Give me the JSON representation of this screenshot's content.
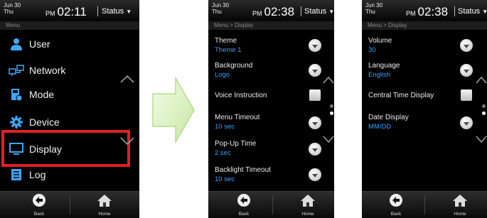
{
  "screens": [
    {
      "date_month": "Jun",
      "date_day": "30",
      "date_weekday": "Thu",
      "ampm": "PM",
      "time": "02:11",
      "status_label": "Status",
      "breadcrumb": "Menu",
      "menu_items": [
        {
          "label": "User",
          "icon": "user-icon"
        },
        {
          "label": "Network",
          "icon": "network-icon"
        },
        {
          "label": "Mode",
          "icon": "mode-icon"
        },
        {
          "label": "Device",
          "icon": "gear-icon"
        },
        {
          "label": "Display",
          "icon": "monitor-icon"
        },
        {
          "label": "Log",
          "icon": "log-icon"
        }
      ],
      "highlighted_item": "Display",
      "back_label": "Back",
      "home_label": "Home"
    },
    {
      "date_month": "Jun",
      "date_day": "30",
      "date_weekday": "Thu",
      "ampm": "PM",
      "time": "02:38",
      "status_label": "Status",
      "breadcrumb": "Menu > Display",
      "settings": [
        {
          "label": "Theme",
          "value": "Theme  1",
          "control": "dropdown"
        },
        {
          "label": "Background",
          "value": "Logo",
          "control": "dropdown"
        },
        {
          "label": "Voice Instruction",
          "value": "",
          "control": "checkbox"
        },
        {
          "label": "Menu Timeout",
          "value": "10 sec",
          "control": "dropdown"
        },
        {
          "label": "Pop-Up Time",
          "value": "2 sec",
          "control": "dropdown"
        },
        {
          "label": "Backlight Timeout",
          "value": "10 sec",
          "control": "dropdown"
        }
      ],
      "page_indicator": {
        "pages": 2,
        "current": 1
      },
      "back_label": "Back",
      "home_label": "Home"
    },
    {
      "date_month": "Jun",
      "date_day": "30",
      "date_weekday": "Thu",
      "ampm": "PM",
      "time": "02:38",
      "status_label": "Status",
      "breadcrumb": "Menu > Display",
      "settings": [
        {
          "label": "Volume",
          "value": "30",
          "control": "dropdown"
        },
        {
          "label": "Language",
          "value": "English",
          "control": "dropdown"
        },
        {
          "label": "Central Time Display",
          "value": "",
          "control": "checkbox"
        },
        {
          "label": "Date Display",
          "value": "MM/DD",
          "control": "dropdown"
        }
      ],
      "page_indicator": {
        "pages": 2,
        "current": 2
      },
      "back_label": "Back",
      "home_label": "Home"
    }
  ],
  "colors": {
    "accent_value": "#3ba4ff",
    "highlight_border": "#e41e25",
    "arrow_fill": "#d8f0b8"
  }
}
